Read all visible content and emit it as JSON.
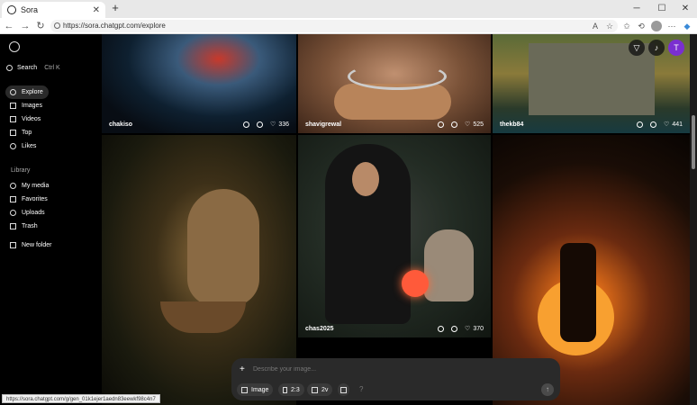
{
  "browser": {
    "tab_title": "Sora",
    "url": "https://sora.chatgpt.com/explore",
    "status_url": "https://sora.chatgpt.com/g/gen_01k1ejer1aedn83eewkf98c4n7"
  },
  "sidebar": {
    "search_label": "Search",
    "search_shortcut": "Ctrl K",
    "items": [
      {
        "label": "Explore",
        "icon": "compass-icon"
      },
      {
        "label": "Images",
        "icon": "image-icon"
      },
      {
        "label": "Videos",
        "icon": "video-icon"
      },
      {
        "label": "Top",
        "icon": "trophy-icon"
      },
      {
        "label": "Likes",
        "icon": "heart-icon"
      }
    ],
    "library_heading": "Library",
    "library_items": [
      {
        "label": "My media",
        "icon": "media-icon"
      },
      {
        "label": "Favorites",
        "icon": "star-icon"
      },
      {
        "label": "Uploads",
        "icon": "upload-icon"
      },
      {
        "label": "Trash",
        "icon": "trash-icon"
      }
    ],
    "new_folder_label": "New folder"
  },
  "gallery": {
    "tiles": [
      {
        "user": "chakiso",
        "likes": "336"
      },
      {
        "user": "shavigrewal",
        "likes": "525"
      },
      {
        "user": "thekb84",
        "likes": "441"
      },
      {
        "user": "chas2025",
        "likes": "370"
      }
    ]
  },
  "composer": {
    "placeholder": "Describe your image...",
    "type_label": "Image",
    "ratio_label": "2:3",
    "variations_label": "2v",
    "help_label": "?"
  },
  "colors": {
    "accent_avatar": "#7a2fd0",
    "background": "#000000"
  },
  "avatar_initial": "T"
}
